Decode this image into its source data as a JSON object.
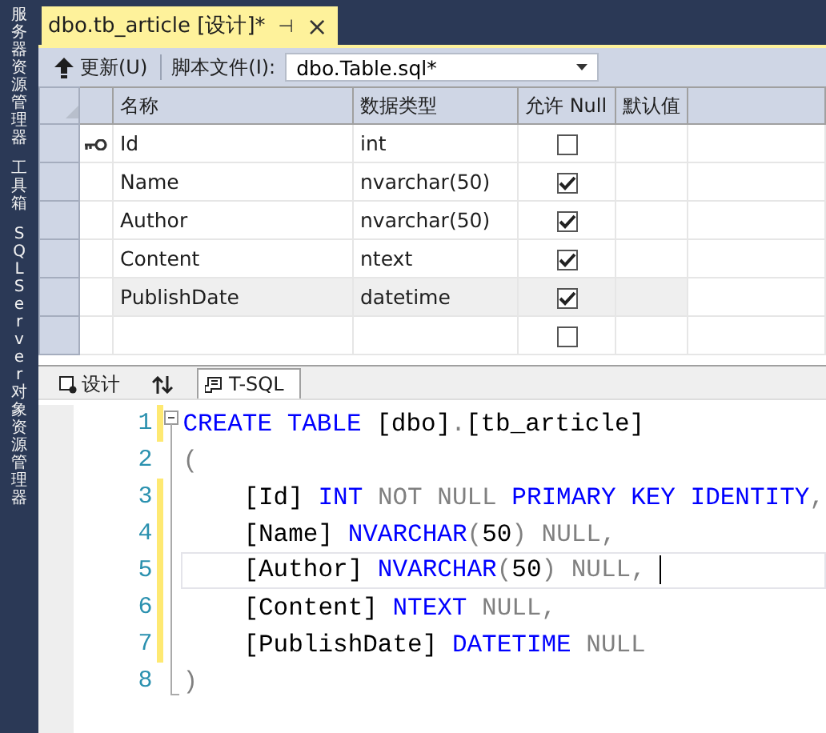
{
  "side_panels": [
    "服务器资源管理器",
    "工具箱",
    "SQL Server 对象资源管理器"
  ],
  "document_tab": {
    "title": "dbo.tb_article [设计]*",
    "pin": "⊣",
    "close": "×"
  },
  "toolbar": {
    "update_button": "更新(U)",
    "script_label": "脚本文件(I):",
    "script_file": "dbo.Table.sql*"
  },
  "grid": {
    "columns": [
      "名称",
      "数据类型",
      "允许 Null",
      "默认值"
    ],
    "rows": [
      {
        "name": "Id",
        "type": "int",
        "allow_null": false,
        "primary_key": true,
        "selected": false
      },
      {
        "name": "Name",
        "type": "nvarchar(50)",
        "allow_null": true,
        "primary_key": false,
        "selected": false
      },
      {
        "name": "Author",
        "type": "nvarchar(50)",
        "allow_null": true,
        "primary_key": false,
        "selected": false
      },
      {
        "name": "Content",
        "type": "ntext",
        "allow_null": true,
        "primary_key": false,
        "selected": false
      },
      {
        "name": "PublishDate",
        "type": "datetime",
        "allow_null": true,
        "primary_key": false,
        "selected": true
      },
      {
        "allow_null": false,
        "primary_key": false,
        "selected": false
      }
    ]
  },
  "view_tabs": [
    {
      "kind": "design",
      "label": "设计",
      "selected": false
    },
    {
      "kind": "sort",
      "selected": false
    },
    {
      "kind": "tsql",
      "label": "T-SQL",
      "selected": true
    }
  ],
  "editor": {
    "lines": [
      {
        "number": "1",
        "changed": true,
        "current": false,
        "indented": false,
        "tokens": [
          {
            "t": "CREATE TABLE",
            "kind": "kw"
          },
          {
            "t": " [dbo]",
            "kind": "id"
          },
          {
            "t": ".",
            "kind": "op"
          },
          {
            "t": "[tb_article]",
            "kind": "id"
          }
        ]
      },
      {
        "number": "2",
        "changed": false,
        "current": false,
        "indented": false,
        "tokens": [
          {
            "t": "(",
            "kind": "op"
          }
        ]
      },
      {
        "number": "3",
        "changed": true,
        "current": false,
        "indented": true,
        "tokens": [
          {
            "t": "[Id] ",
            "kind": "id"
          },
          {
            "t": "INT ",
            "kind": "kw"
          },
          {
            "t": "NOT NULL ",
            "kind": "op"
          },
          {
            "t": "PRIMARY KEY IDENTITY",
            "kind": "kw"
          },
          {
            "t": ",",
            "kind": "op"
          }
        ]
      },
      {
        "number": "4",
        "changed": true,
        "current": false,
        "indented": true,
        "tokens": [
          {
            "t": "[Name] ",
            "kind": "id"
          },
          {
            "t": "NVARCHAR",
            "kind": "kw"
          },
          {
            "t": "(",
            "kind": "op"
          },
          {
            "t": "50",
            "kind": "id"
          },
          {
            "t": ") NULL,",
            "kind": "op"
          }
        ]
      },
      {
        "number": "5",
        "changed": true,
        "current": true,
        "indented": true,
        "tokens": [
          {
            "t": "[Author] ",
            "kind": "id"
          },
          {
            "t": "NVARCHAR",
            "kind": "kw"
          },
          {
            "t": "(",
            "kind": "op"
          },
          {
            "t": "50",
            "kind": "id"
          },
          {
            "t": ") NULL,",
            "kind": "op"
          }
        ]
      },
      {
        "number": "6",
        "changed": true,
        "current": false,
        "indented": true,
        "tokens": [
          {
            "t": "[Content] ",
            "kind": "id"
          },
          {
            "t": "NTEXT ",
            "kind": "kw"
          },
          {
            "t": "NULL,",
            "kind": "op"
          }
        ]
      },
      {
        "number": "7",
        "changed": true,
        "current": false,
        "indented": true,
        "tokens": [
          {
            "t": "[PublishDate] ",
            "kind": "id"
          },
          {
            "t": "DATETIME ",
            "kind": "kw"
          },
          {
            "t": "NULL",
            "kind": "op"
          }
        ]
      },
      {
        "number": "8",
        "changed": false,
        "current": false,
        "indented": false,
        "tokens": [
          {
            "t": ")",
            "kind": "op"
          }
        ]
      }
    ]
  }
}
